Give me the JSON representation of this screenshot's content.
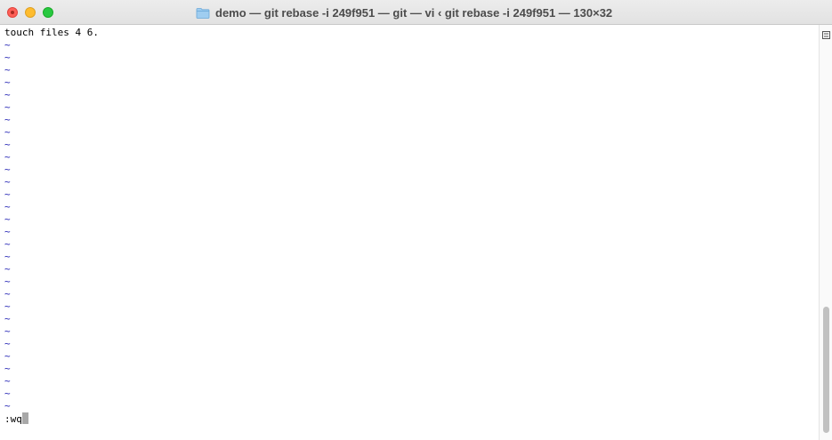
{
  "window": {
    "title": "demo — git rebase -i 249f951 — git — vi ‹ git rebase -i 249f951 — 130×32",
    "folder_icon": "folder-icon"
  },
  "editor": {
    "first_line": "touch files 4 6.",
    "empty_line_marker": "~",
    "empty_line_count": 30,
    "command_line": ":wq"
  },
  "colors": {
    "tilde": "#1f1fb3",
    "close": "#ff5f57",
    "minimize": "#febc2e",
    "zoom": "#28c840",
    "cursor": "#a8a8a8"
  }
}
